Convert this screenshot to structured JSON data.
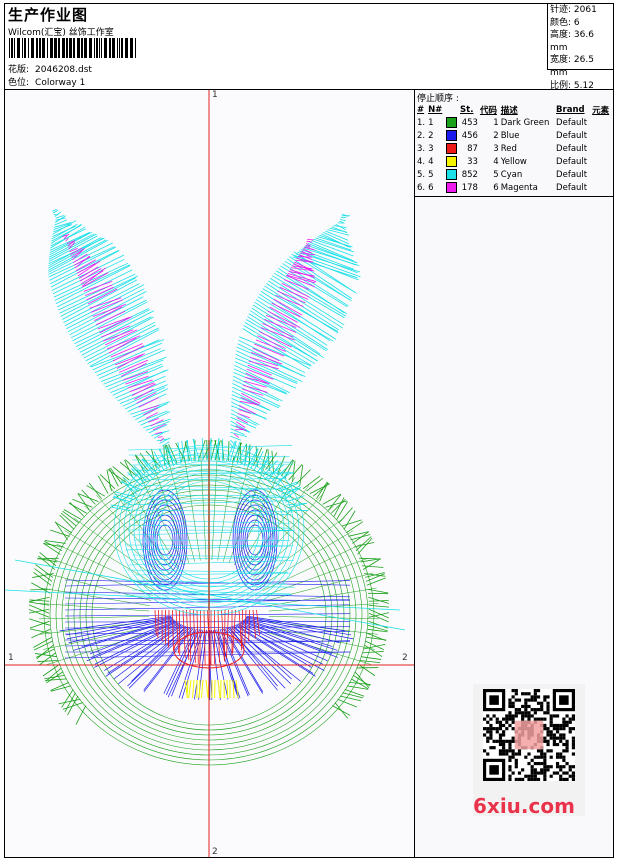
{
  "header": {
    "title": "生产作业图",
    "studio": "Wilcom(汇宝) 丝饰工作室",
    "design_label": "花版:",
    "design_value": "2046208.dst",
    "colorway_label": "色位:",
    "colorway_value": "Colorway 1"
  },
  "stats": {
    "stitches": "针迹: 2061",
    "colors": "颜色: 6",
    "height": "高度: 36.6 mm",
    "width": "宽度: 26.5 mm",
    "scale": "比例: 5.12"
  },
  "axes": {
    "top": "1",
    "bottom": "2",
    "left": "1",
    "right": "2"
  },
  "sequence": {
    "title": "停止顺序 :",
    "columns": [
      "#",
      "N#",
      "St.",
      "代码",
      "描述",
      "Brand",
      "元素"
    ],
    "rows": [
      {
        "idx": "1.",
        "n": "1",
        "color": "#1aa01a",
        "st": "453",
        "code": "1",
        "desc": "Dark Green",
        "brand": "Default"
      },
      {
        "idx": "2.",
        "n": "2",
        "color": "#1a1aee",
        "st": "456",
        "code": "2",
        "desc": "Blue",
        "brand": "Default"
      },
      {
        "idx": "3.",
        "n": "3",
        "color": "#ee1a1a",
        "st": "87",
        "code": "3",
        "desc": "Red",
        "brand": "Default"
      },
      {
        "idx": "4.",
        "n": "4",
        "color": "#f5f500",
        "st": "33",
        "code": "4",
        "desc": "Yellow",
        "brand": "Default"
      },
      {
        "idx": "5.",
        "n": "5",
        "color": "#1ae0e8",
        "st": "852",
        "code": "5",
        "desc": "Cyan",
        "brand": "Default"
      },
      {
        "idx": "6.",
        "n": "6",
        "color": "#ee1aee",
        "st": "178",
        "code": "6",
        "desc": "Magenta",
        "brand": "Default"
      }
    ]
  },
  "watermark": "6xiu.com",
  "colors": {
    "green": "#1aa01a",
    "blue": "#1a1aee",
    "red": "#ee1a1a",
    "yellow": "#f5f500",
    "cyan": "#1ae0e8",
    "magenta": "#ee1aee",
    "axis": "#e02020"
  }
}
